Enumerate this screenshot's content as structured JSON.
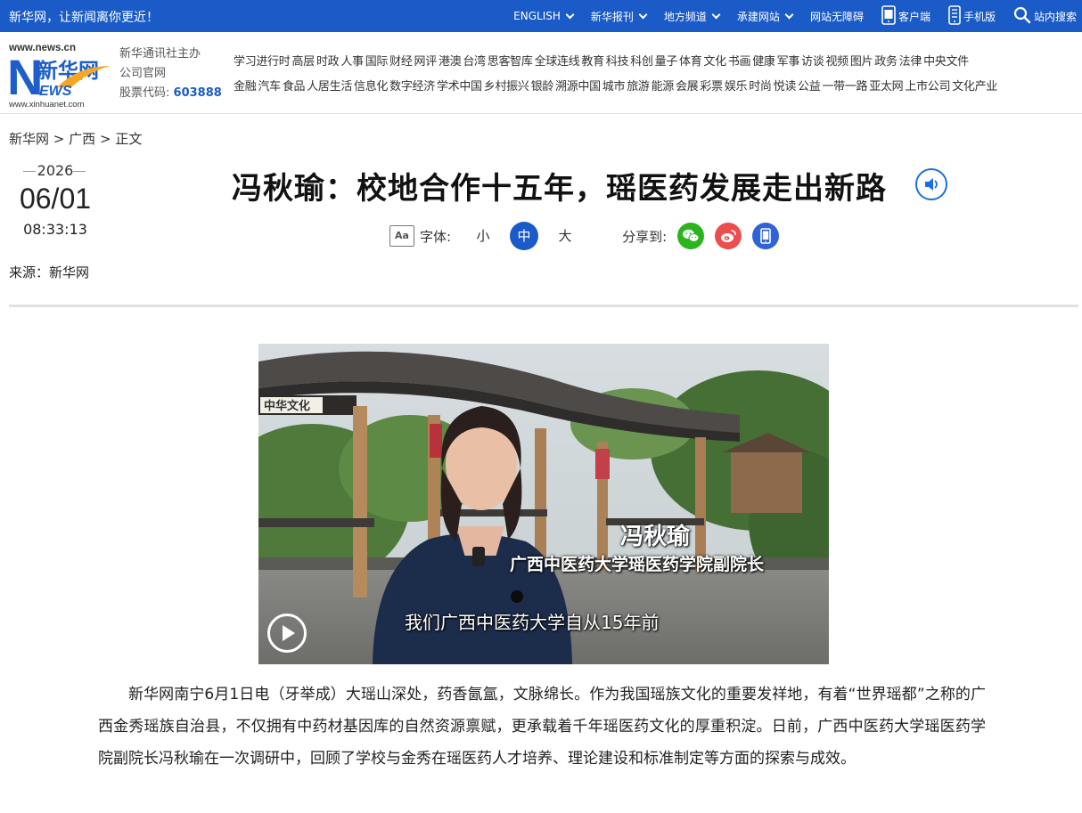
{
  "topbar": {
    "slogan": "新华网，让新闻离你更近！",
    "nav": [
      {
        "label": "ENGLISH",
        "dropdown": true
      },
      {
        "label": "新华报刊",
        "dropdown": true
      },
      {
        "label": "地方频道",
        "dropdown": true
      },
      {
        "label": "承建网站",
        "dropdown": true
      },
      {
        "label": "网站无障碍",
        "dropdown": false
      }
    ],
    "client_label": "客户端",
    "mobile_label": "手机版",
    "search_label": "站内搜索"
  },
  "header": {
    "logo_domain": "www.news.cn",
    "logo_name": "新华网",
    "logo_news": "EWS",
    "logo_url": "www.xinhuanet.com",
    "sponsor": "新华通讯社主办",
    "official": "公司官网",
    "stock_label": "股票代码:",
    "stock_code": "603888",
    "channels_row1": [
      "学习进行时",
      "高层",
      "时政",
      "人事",
      "国际",
      "财经",
      "网评",
      "港澳",
      "台湾",
      "思客智库",
      "全球连线",
      "教育",
      "科技",
      "科创",
      "量子",
      "体育",
      "文化",
      "书画",
      "健康",
      "军事",
      "访谈",
      "视频",
      "图片",
      "政务",
      "法律",
      "中央文件"
    ],
    "channels_row2": [
      "金融",
      "汽车",
      "食品",
      "人居生活",
      "信息化",
      "数字经济",
      "学术中国",
      "乡村振兴",
      "银龄",
      "溯源中国",
      "城市",
      "旅游",
      "能源",
      "会展",
      "彩票",
      "娱乐",
      "时尚",
      "悦读",
      "公益",
      "一带一路",
      "亚太网",
      "上市公司",
      "文化产业"
    ]
  },
  "breadcrumb": {
    "home": "新华网",
    "section": "广西",
    "current": "正文",
    "sep": ">"
  },
  "date": {
    "year": "2026",
    "month_day": "06/01",
    "time": "08:33:13"
  },
  "source": "来源：新华网",
  "title": "冯秋瑜：校地合作十五年，瑶医药发展走出新路",
  "tools": {
    "font_label": "字体:",
    "sizes": [
      "小",
      "中",
      "大"
    ],
    "active_size": "中",
    "share_label": "分享到:"
  },
  "video": {
    "name_caption": "冯秋瑜",
    "role_caption": "广西中医药大学瑶医药学院副院长",
    "subtitle": "我们广西中医药大学自从15年前",
    "sign_text": "中华文化"
  },
  "article": {
    "paragraph": "新华网南宁6月1日电（牙举成）大瑶山深处，药香氤氲，文脉绵长。作为我国瑶族文化的重要发祥地，有着“世界瑶都”之称的广西金秀瑶族自治县，不仅拥有中药材基因库的自然资源禀赋，更承载着千年瑶医药文化的厚重积淀。日前，广西中医药大学瑶医药学院副院长冯秋瑜在一次调研中，回顾了学校与金秀在瑶医药人才培养、理论建设和标准制定等方面的探索与成效。"
  },
  "colors": {
    "brand_blue": "#1b5bc7",
    "audio_blue": "#1b6fe0",
    "wechat_green": "#29b51c",
    "weibo_red": "#ec4d4d"
  }
}
